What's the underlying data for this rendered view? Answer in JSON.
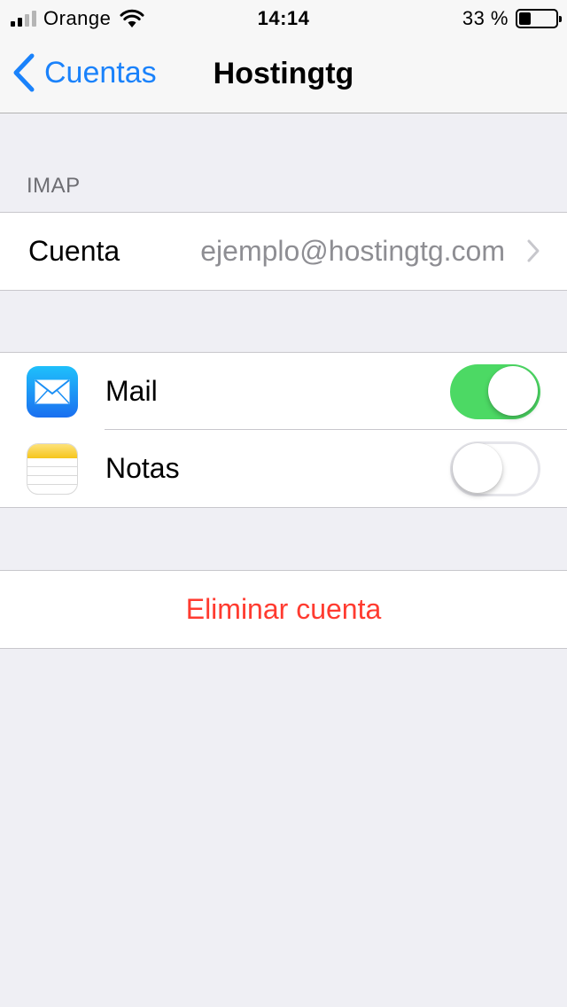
{
  "status_bar": {
    "carrier": "Orange",
    "time": "14:14",
    "battery_percent_label": "33 %",
    "battery_level": 0.33,
    "signal_bars_active": 2,
    "signal_bars_total": 4
  },
  "nav": {
    "back_label": "Cuentas",
    "title": "Hostingtg"
  },
  "imap_section": {
    "header": "IMAP",
    "account_label": "Cuenta",
    "account_value": "ejemplo@hostingtg.com"
  },
  "apps": [
    {
      "icon": "mail-app-icon",
      "label": "Mail",
      "enabled": true
    },
    {
      "icon": "notes-app-icon",
      "label": "Notas",
      "enabled": false
    }
  ],
  "actions": {
    "delete_label": "Eliminar cuenta"
  },
  "colors": {
    "accent": "#1a82fb",
    "toggle_on": "#4cd964",
    "destructive": "#ff3b30",
    "background": "#efeff4"
  }
}
